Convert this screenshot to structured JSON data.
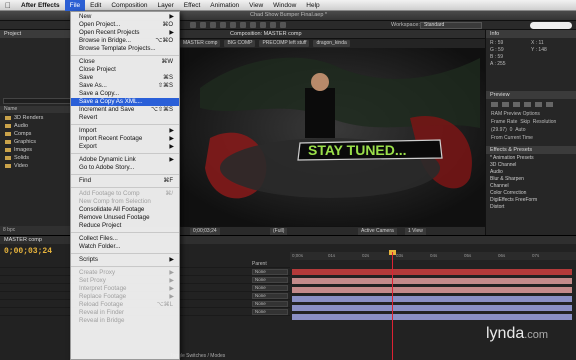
{
  "menubar": {
    "app": "After Effects",
    "items": [
      "File",
      "Edit",
      "Composition",
      "Layer",
      "Effect",
      "Animation",
      "View",
      "Window",
      "Help"
    ]
  },
  "window": {
    "title": "Chad Show Bumper Final.aep *"
  },
  "toolbar": {
    "workspace_label": "Workspace:",
    "workspace_value": "Standard"
  },
  "project_panel": {
    "tab": "Project",
    "header": "Name",
    "folders": [
      "3D Renders",
      "Audio",
      "Comps",
      "Graphics",
      "Images",
      "Solids",
      "Video"
    ],
    "bpc": "8 bpc"
  },
  "composition": {
    "tab": "Composition: MASTER comp",
    "breadcrumbs": [
      "MASTER comp",
      "BIG COMP",
      "PRECOMP left stuff",
      "dragon_kinda"
    ],
    "artwork_text": "STAY TUNED...",
    "viewer_controls": {
      "timecode": "0;00;03;24",
      "resolution": "(Full)",
      "camera": "Active Camera",
      "views": "1 View"
    }
  },
  "info_panel": {
    "tab": "Info",
    "values": [
      "R : 59",
      "X : 11",
      "G : 59",
      "Y : 148",
      "B : 59",
      "",
      "A : 255",
      ""
    ]
  },
  "preview_panel": {
    "tab": "Preview",
    "ram_label": "RAM Preview Options",
    "frame_rate": "Frame Rate",
    "skip": "Skip",
    "resolution": "Resolution",
    "frame_rate_value": "(29.97)",
    "skip_value": "0",
    "resolution_value": "Auto",
    "from_current": "From Current Time"
  },
  "effects_panel": {
    "tab": "Effects & Presets",
    "items": [
      "* Animation Presets",
      "3D Channel",
      "Audio",
      "Blur & Sharpen",
      "Channel",
      "Color Correction",
      "DigiEffects FreeForm",
      "Distort"
    ]
  },
  "timeline": {
    "tab": "MASTER comp",
    "timecode": "0;00;03;24",
    "parent_label": "Parent",
    "rows": [
      "None",
      "None",
      "None",
      "None",
      "None",
      "None"
    ],
    "ruler": [
      "0;00s",
      "01s",
      "02s",
      "03s",
      "04s",
      "05s",
      "06s",
      "07s"
    ],
    "footer": "Toggle Switches / Modes"
  },
  "file_menu": {
    "items": [
      {
        "label": "New",
        "shortcut": "",
        "submenu": true,
        "disabled": false,
        "highlight": false
      },
      {
        "label": "Open Project...",
        "shortcut": "⌘O",
        "submenu": false,
        "disabled": false,
        "highlight": false
      },
      {
        "label": "Open Recent Projects",
        "shortcut": "",
        "submenu": true,
        "disabled": false,
        "highlight": false
      },
      {
        "label": "Browse in Bridge...",
        "shortcut": "⌥⌘O",
        "submenu": false,
        "disabled": false,
        "highlight": false
      },
      {
        "label": "Browse Template Projects...",
        "shortcut": "",
        "submenu": false,
        "disabled": false,
        "highlight": false
      },
      {
        "sep": true
      },
      {
        "label": "Close",
        "shortcut": "⌘W",
        "submenu": false,
        "disabled": false,
        "highlight": false
      },
      {
        "label": "Close Project",
        "shortcut": "",
        "submenu": false,
        "disabled": false,
        "highlight": false
      },
      {
        "label": "Save",
        "shortcut": "⌘S",
        "submenu": false,
        "disabled": false,
        "highlight": false
      },
      {
        "label": "Save As...",
        "shortcut": "⇧⌘S",
        "submenu": false,
        "disabled": false,
        "highlight": false
      },
      {
        "label": "Save a Copy...",
        "shortcut": "",
        "submenu": false,
        "disabled": false,
        "highlight": false
      },
      {
        "label": "Save a Copy As XML...",
        "shortcut": "",
        "submenu": false,
        "disabled": false,
        "highlight": true
      },
      {
        "label": "Increment and Save",
        "shortcut": "⌥⇧⌘S",
        "submenu": false,
        "disabled": false,
        "highlight": false
      },
      {
        "label": "Revert",
        "shortcut": "",
        "submenu": false,
        "disabled": false,
        "highlight": false
      },
      {
        "sep": true
      },
      {
        "label": "Import",
        "shortcut": "",
        "submenu": true,
        "disabled": false,
        "highlight": false
      },
      {
        "label": "Import Recent Footage",
        "shortcut": "",
        "submenu": true,
        "disabled": false,
        "highlight": false
      },
      {
        "label": "Export",
        "shortcut": "",
        "submenu": true,
        "disabled": false,
        "highlight": false
      },
      {
        "sep": true
      },
      {
        "label": "Adobe Dynamic Link",
        "shortcut": "",
        "submenu": true,
        "disabled": false,
        "highlight": false
      },
      {
        "label": "Go to Adobe Story...",
        "shortcut": "",
        "submenu": false,
        "disabled": false,
        "highlight": false
      },
      {
        "sep": true
      },
      {
        "label": "Find",
        "shortcut": "⌘F",
        "submenu": false,
        "disabled": false,
        "highlight": false
      },
      {
        "sep": true
      },
      {
        "label": "Add Footage to Comp",
        "shortcut": "⌘/",
        "submenu": false,
        "disabled": true,
        "highlight": false
      },
      {
        "label": "New Comp from Selection",
        "shortcut": "",
        "submenu": false,
        "disabled": true,
        "highlight": false
      },
      {
        "label": "Consolidate All Footage",
        "shortcut": "",
        "submenu": false,
        "disabled": false,
        "highlight": false
      },
      {
        "label": "Remove Unused Footage",
        "shortcut": "",
        "submenu": false,
        "disabled": false,
        "highlight": false
      },
      {
        "label": "Reduce Project",
        "shortcut": "",
        "submenu": false,
        "disabled": false,
        "highlight": false
      },
      {
        "sep": true
      },
      {
        "label": "Collect Files...",
        "shortcut": "",
        "submenu": false,
        "disabled": false,
        "highlight": false
      },
      {
        "label": "Watch Folder...",
        "shortcut": "",
        "submenu": false,
        "disabled": false,
        "highlight": false
      },
      {
        "sep": true
      },
      {
        "label": "Scripts",
        "shortcut": "",
        "submenu": true,
        "disabled": false,
        "highlight": false
      },
      {
        "sep": true
      },
      {
        "label": "Create Proxy",
        "shortcut": "",
        "submenu": true,
        "disabled": true,
        "highlight": false
      },
      {
        "label": "Set Proxy",
        "shortcut": "",
        "submenu": true,
        "disabled": true,
        "highlight": false
      },
      {
        "label": "Interpret Footage",
        "shortcut": "",
        "submenu": true,
        "disabled": true,
        "highlight": false
      },
      {
        "label": "Replace Footage",
        "shortcut": "",
        "submenu": true,
        "disabled": true,
        "highlight": false
      },
      {
        "label": "Reload Footage",
        "shortcut": "⌥⌘L",
        "submenu": false,
        "disabled": true,
        "highlight": false
      },
      {
        "label": "Reveal in Finder",
        "shortcut": "",
        "submenu": false,
        "disabled": true,
        "highlight": false
      },
      {
        "label": "Reveal in Bridge",
        "shortcut": "",
        "submenu": false,
        "disabled": true,
        "highlight": false
      }
    ]
  },
  "watermark": {
    "brand": "lynda",
    "suffix": ".com"
  },
  "colors": {
    "menu_highlight": "#2a5fd8",
    "timecode": "#e8b43c",
    "playhead": "#dd2233",
    "title_green": "#9be04a"
  }
}
